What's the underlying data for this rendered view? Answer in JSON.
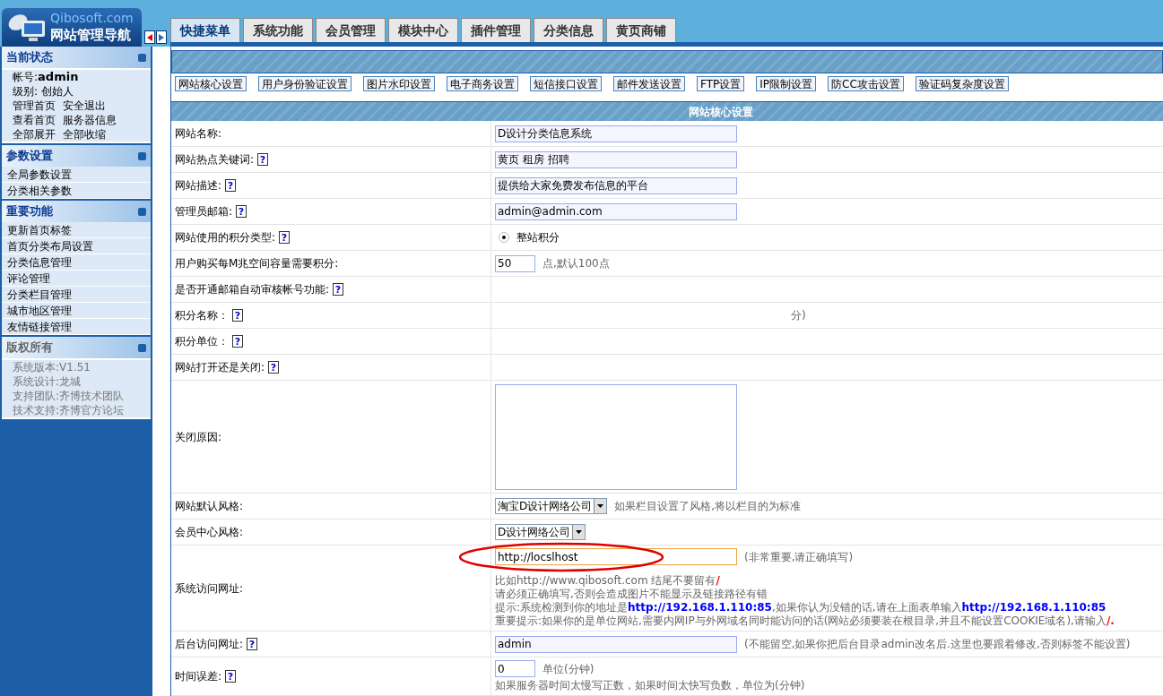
{
  "brand": {
    "site": "Qibosoft.com",
    "title": "网站管理导航"
  },
  "sidebar": [
    {
      "title": "当前状态",
      "muted": false,
      "kind": "info",
      "lines": [
        [
          "帐号:**admin**"
        ],
        [
          "级别: 创始人"
        ],
        [
          "管理首页",
          "安全退出"
        ],
        [
          "查看首页",
          "服务器信息"
        ],
        [
          "全部展开",
          "全部收缩"
        ]
      ]
    },
    {
      "title": "参数设置",
      "muted": false,
      "kind": "links",
      "lines": [
        [
          "全局参数设置"
        ],
        [
          "分类相关参数"
        ]
      ]
    },
    {
      "title": "重要功能",
      "muted": false,
      "kind": "links",
      "lines": [
        [
          "更新首页标签"
        ],
        [
          "首页分类布局设置"
        ],
        [
          "分类信息管理"
        ],
        [
          "评论管理"
        ],
        [
          "分类栏目管理"
        ],
        [
          "城市地区管理"
        ],
        [
          "友情链接管理"
        ]
      ]
    },
    {
      "title": "版权所有",
      "muted": true,
      "kind": "info",
      "lines": [
        [
          "系统版本:V1.51"
        ],
        [
          "系统设计:龙城"
        ],
        [
          "支持团队:齐博技术团队"
        ],
        [
          "技术支持:齐博官方论坛"
        ]
      ]
    }
  ],
  "tabs": [
    {
      "label": "快捷菜单",
      "selected": true
    },
    {
      "label": "系统功能",
      "selected": false
    },
    {
      "label": "会员管理",
      "selected": false
    },
    {
      "label": "模块中心",
      "selected": false
    },
    {
      "label": "插件管理",
      "selected": false
    },
    {
      "label": "分类信息",
      "selected": false
    },
    {
      "label": "黄页商铺",
      "selected": false
    }
  ],
  "subnav": [
    "网站核心设置",
    "用户身份验证设置",
    "图片水印设置",
    "电子商务设置",
    "短信接口设置",
    "邮件发送设置",
    "FTP设置",
    "IP限制设置",
    "防CC攻击设置",
    "验证码复杂度设置"
  ],
  "form": {
    "title": "网站核心设置",
    "rows": [
      {
        "label": "网站名称:",
        "kind": "text",
        "value": "D设计分类信息系统"
      },
      {
        "label": "网站热点关键词:",
        "help": "?",
        "kind": "text",
        "value": "黄页 租房 招聘"
      },
      {
        "label": "网站描述:",
        "help": "?",
        "kind": "text",
        "value": "提供给大家免费发布信息的平台"
      },
      {
        "label": "管理员邮箱:",
        "help": "?",
        "kind": "text",
        "value": "admin@admin.com"
      },
      {
        "label": "网站使用的积分类型:",
        "help": "?",
        "kind": "radio",
        "options": [
          {
            "label": "整站积分",
            "selected": true
          }
        ]
      },
      {
        "label": "用户购买每M兆空间容量需要积分:",
        "kind": "short",
        "value": "50",
        "suffix": "点,默认100点"
      },
      {
        "label": "是否开通邮箱自动审核帐号功能:",
        "help": "?",
        "kind": "empty"
      },
      {
        "label": "积分名称：",
        "help": "?",
        "kind": "fragment",
        "value": "分)"
      },
      {
        "label": "积分单位：",
        "help": "?",
        "kind": "empty"
      },
      {
        "label": "网站打开还是关闭:",
        "help": "?",
        "kind": "empty"
      },
      {
        "label": "关闭原因:",
        "kind": "textarea"
      },
      {
        "label": "网站默认风格:",
        "kind": "select",
        "value": "淘宝D设计网络公司",
        "suffix": "如果栏目设置了风格,将以栏目的为标准"
      },
      {
        "label": "会员中心风格:",
        "kind": "select",
        "value": "D设计网络公司"
      },
      {
        "label": "系统访问网址:",
        "kind": "url",
        "value": "http://locslhost",
        "suffix": "(非常重要,请正确填写)",
        "notes": [
          {
            "text": "比如http://www.qibosoft.com 结尾不要留有**/**",
            "kind": "warning"
          },
          {
            "text": "请必须正确填写,否则会造成图片不能显示及链接路径有错",
            "kind": "plain"
          },
          {
            "text": "提示:系统检测到你的地址是**http://192.168.1.110:85**,如果你认为没错的话,请在上面表单输入**http://192.168.1.110:85**",
            "kind": "tip"
          },
          {
            "text": "重要提示:如果你的是单位网站,需要内网IP与外网域名同时能访问的话(网站必须要装在根目录,并且不能设置COOKIE域名),请输入**/.**",
            "kind": "warning"
          }
        ]
      },
      {
        "label": "后台访问网址:",
        "help": "?",
        "kind": "text",
        "value": "admin",
        "suffix": "(不能留空,如果你把后台目录admin改名后.这里也要跟着修改,否则标签不能设置)"
      },
      {
        "label": "时间误差:",
        "help": "?",
        "kind": "short",
        "value": "0",
        "suffix": "单位(分钟)",
        "notes": [
          {
            "text": "如果服务器时间太慢写正数，如果时间太快写负数，单位为(分钟)",
            "kind": "plain"
          }
        ]
      }
    ]
  }
}
